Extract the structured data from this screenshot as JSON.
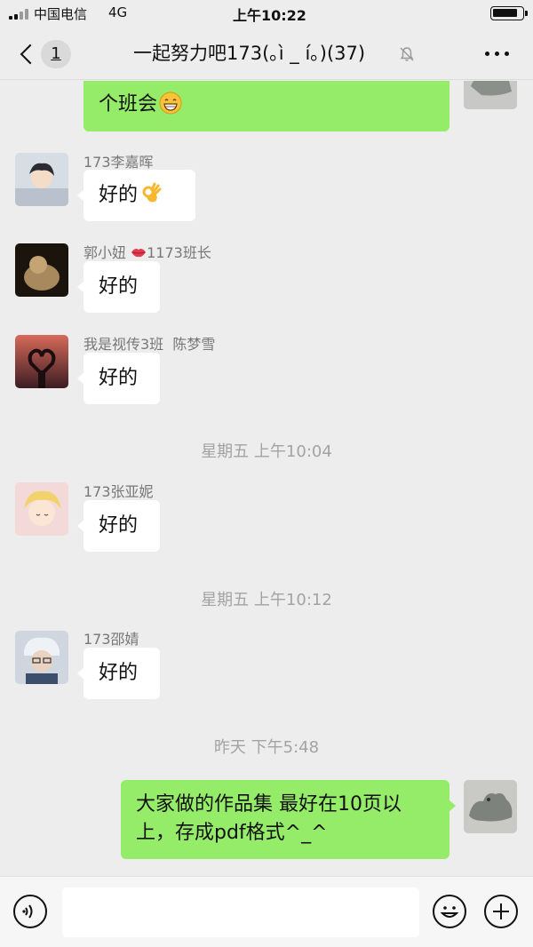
{
  "status": {
    "carrier": "中国电信",
    "network": "4G",
    "time": "上午10:22"
  },
  "nav": {
    "unread_count": "1",
    "title": "一起努力吧173(｡ì _ í｡)(37)"
  },
  "messages": [
    {
      "type": "out",
      "text": "个班会"
    },
    {
      "type": "in",
      "sender": "173李嘉晖",
      "text": "好的",
      "emoji": "ok-hand"
    },
    {
      "type": "in",
      "sender": "郭小妞",
      "sender_suffix": "1173班长",
      "text": "好的"
    },
    {
      "type": "in",
      "sender": "我是视传3班  陈梦雪",
      "text": "好的"
    },
    {
      "type": "time",
      "text": "星期五 上午10:04"
    },
    {
      "type": "in",
      "sender": "173张亚妮",
      "text": "好的"
    },
    {
      "type": "time",
      "text": "星期五 上午10:12"
    },
    {
      "type": "in",
      "sender": "173邵婧",
      "text": "好的"
    },
    {
      "type": "time",
      "text": "昨天 下午5:48"
    },
    {
      "type": "out",
      "text": "大家做的作品集 最好在10页以上，存成pdf格式^_^"
    }
  ],
  "colors": {
    "background": "#ededed",
    "outgoing_bubble": "#95ec69",
    "incoming_bubble": "#ffffff",
    "timestamp": "#a3a3a3"
  }
}
